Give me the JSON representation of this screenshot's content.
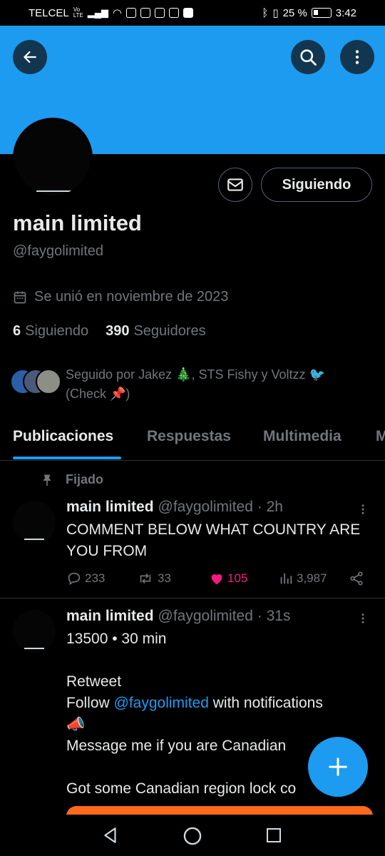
{
  "status": {
    "carrier": "TELCEL",
    "volte": "Vo LTE",
    "battery": "25 %",
    "time": "3:42"
  },
  "profile": {
    "name": "main limited",
    "handle": "@faygolimited",
    "joined": "Se unió en noviembre de 2023",
    "following_count": "6",
    "following_label": "Siguiendo",
    "followers_count": "390",
    "followers_label": "Seguidores",
    "follow_button": "Siguiendo",
    "followed_by": "Seguido por Jakez 🎄, STS Fishy y Voltzz 🐦 (Check 📌)"
  },
  "tabs": [
    {
      "label": "Publicaciones"
    },
    {
      "label": "Respuestas"
    },
    {
      "label": "Multimedia"
    },
    {
      "label": "M"
    }
  ],
  "tweets": [
    {
      "pinned_label": "Fijado",
      "name": "main limited",
      "handle": "@faygolimited",
      "time": "· 2h",
      "text": "COMMENT BELOW WHAT COUNTRY ARE YOU FROM",
      "replies": "233",
      "retweets": "33",
      "likes": "105",
      "views": "3,987"
    },
    {
      "name": "main limited",
      "handle": "@faygolimited",
      "time": "· 31s",
      "line1": "13500 • 30 min",
      "line2": "Retweet",
      "line3_pre": "Follow ",
      "line3_link": "@faygolimited",
      "line3_post": " with notifications",
      "line4": "📣",
      "line5": "Message me if you are Canadian",
      "line6": "Got some Canadian region lock co"
    }
  ],
  "colors": {
    "accent": "#1d9bf0",
    "like": "#f91880",
    "banner": "#1d9bf0"
  }
}
